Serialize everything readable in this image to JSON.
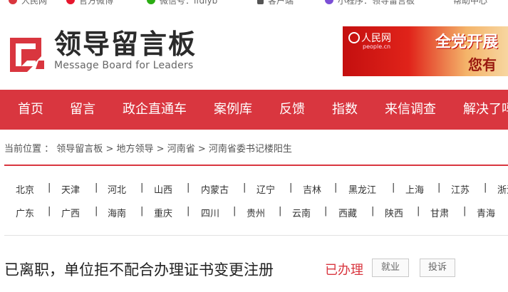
{
  "topbar": {
    "items": [
      {
        "label": "人民网",
        "icon": "people-daily-icon",
        "color": "#d9363f"
      },
      {
        "label": "官方微博",
        "icon": "weibo-icon",
        "color": "#e6162d"
      },
      {
        "label": "微信号：lfdlyb",
        "icon": "wechat-icon",
        "color": "#2bad13"
      },
      {
        "label": "客户端",
        "icon": "mobile-icon",
        "color": "#555555"
      },
      {
        "label": "小程序：领导留言板",
        "icon": "mini-program-icon",
        "color": "#7b4fd6"
      },
      {
        "label": "帮助中心",
        "icon": "",
        "color": ""
      }
    ]
  },
  "logo": {
    "title": "领导留言板",
    "subtitle": "Message Board for Leaders",
    "icon": "message-board-logo-icon",
    "color": "#d9363f"
  },
  "banner": {
    "brand": "人民网",
    "url": "people.cn",
    "headline": "全党开展",
    "subline": "您有"
  },
  "nav": {
    "items": [
      "首页",
      "留言",
      "政企直通车",
      "案例库",
      "反馈",
      "指数",
      "来信调查",
      "解决了吗"
    ],
    "background": "#d9363f"
  },
  "breadcrumb": {
    "prefix": "当前位置 ：",
    "items": [
      "领导留言板",
      "地方领导",
      "河南省",
      "河南省委书记楼阳生"
    ],
    "separator": ">"
  },
  "regions": {
    "row1": [
      "北京",
      "天津",
      "河北",
      "山西",
      "内蒙古",
      "辽宁",
      "吉林",
      "黑龙江",
      "上海",
      "江苏",
      "浙江"
    ],
    "row2": [
      "广东",
      "广西",
      "海南",
      "重庆",
      "四川",
      "贵州",
      "云南",
      "西藏",
      "陕西",
      "甘肃",
      "青海"
    ]
  },
  "message": {
    "title": "已离职，单位拒不配合办理证书变更注册",
    "status": "已办理",
    "tags": [
      "就业",
      "投诉"
    ]
  }
}
